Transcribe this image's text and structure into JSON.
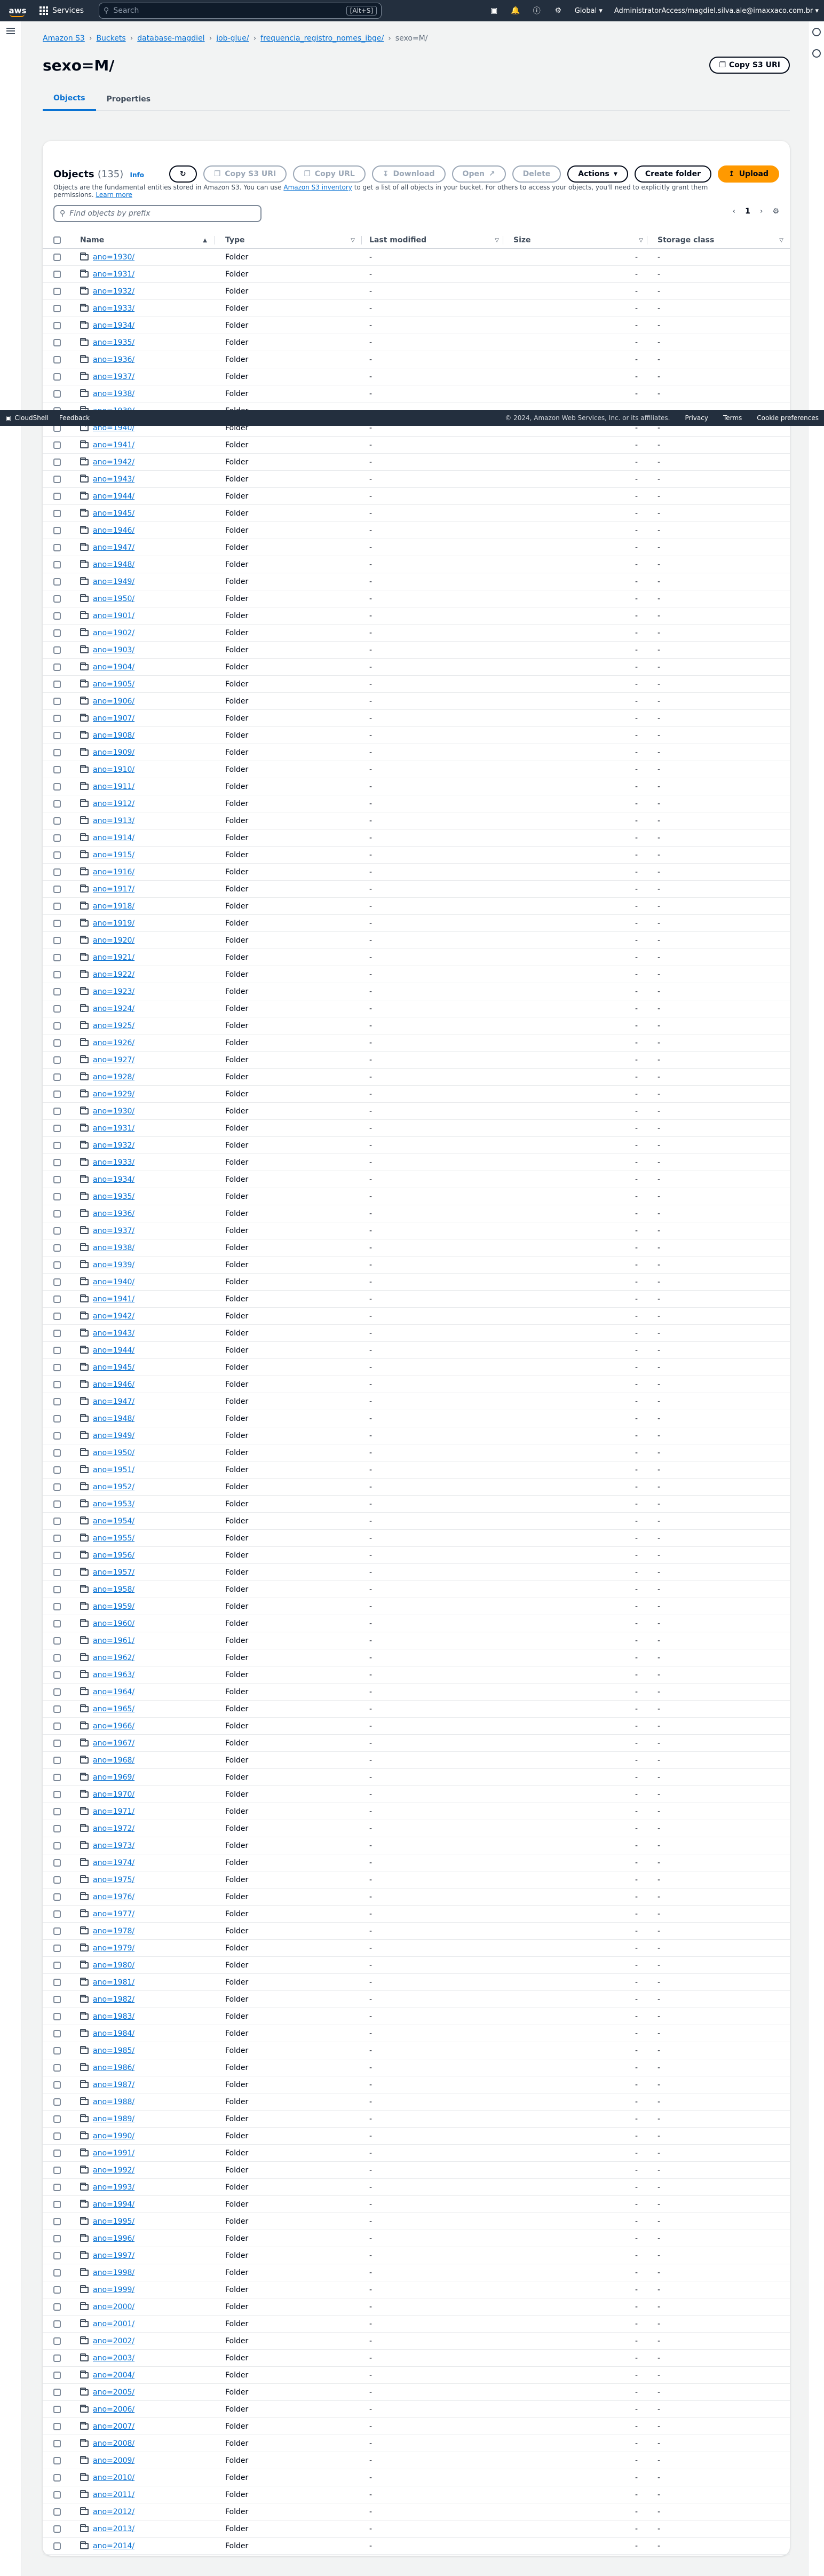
{
  "nav": {
    "logo": "aws",
    "services_label": "Services",
    "search_placeholder": "Search",
    "search_shortcut": "[Alt+S]",
    "region": "Global",
    "account": "AdministratorAccess/magdiel.silva.ale@imaxxaco.com.br"
  },
  "breadcrumb": [
    "Amazon S3",
    "Buckets",
    "database-magdiel",
    "job-glue/",
    "frequencia_registro_nomes_ibge/",
    "sexo=M/"
  ],
  "page": {
    "title": "sexo=M/",
    "copy_uri": "Copy S3 URI"
  },
  "tabs": [
    "Objects",
    "Properties"
  ],
  "objects": {
    "title": "Objects",
    "count": "(135)",
    "info": "Info",
    "desc_pre": "Objects are the fundamental entities stored in Amazon S3. You can use",
    "inventory_link": "Amazon S3 inventory",
    "desc_mid": "to get a list of all objects in your bucket. For others to access your objects, you'll need to explicitly grant them permissions.",
    "learn_more": "Learn more",
    "buttons": {
      "copy_uri": "Copy S3 URI",
      "copy_url": "Copy URL",
      "download": "Download",
      "open": "Open",
      "delete": "Delete",
      "actions": "Actions",
      "create_folder": "Create folder",
      "upload": "Upload"
    },
    "filter_placeholder": "Find objects by prefix",
    "page_number": "1",
    "columns": [
      "Name",
      "Type",
      "Last modified",
      "Size",
      "Storage class"
    ],
    "row_type": "Folder",
    "row_dash": "-",
    "names": [
      "ano=1930/",
      "ano=1931/",
      "ano=1932/",
      "ano=1933/",
      "ano=1934/",
      "ano=1935/",
      "ano=1936/",
      "ano=1937/",
      "ano=1938/",
      "ano=1939/",
      "ano=1940/",
      "ano=1941/",
      "ano=1942/",
      "ano=1943/",
      "ano=1944/",
      "ano=1945/",
      "ano=1946/",
      "ano=1947/",
      "ano=1948/",
      "ano=1949/",
      "ano=1950/",
      "ano=1901/",
      "ano=1902/",
      "ano=1903/",
      "ano=1904/",
      "ano=1905/",
      "ano=1906/",
      "ano=1907/",
      "ano=1908/",
      "ano=1909/",
      "ano=1910/",
      "ano=1911/",
      "ano=1912/",
      "ano=1913/",
      "ano=1914/",
      "ano=1915/",
      "ano=1916/",
      "ano=1917/",
      "ano=1918/",
      "ano=1919/",
      "ano=1920/",
      "ano=1921/",
      "ano=1922/",
      "ano=1923/",
      "ano=1924/",
      "ano=1925/",
      "ano=1926/",
      "ano=1927/",
      "ano=1928/",
      "ano=1929/",
      "ano=1930/",
      "ano=1931/",
      "ano=1932/",
      "ano=1933/",
      "ano=1934/",
      "ano=1935/",
      "ano=1936/",
      "ano=1937/",
      "ano=1938/",
      "ano=1939/",
      "ano=1940/",
      "ano=1941/",
      "ano=1942/",
      "ano=1943/",
      "ano=1944/",
      "ano=1945/",
      "ano=1946/",
      "ano=1947/",
      "ano=1948/",
      "ano=1949/",
      "ano=1950/",
      "ano=1951/",
      "ano=1952/",
      "ano=1953/",
      "ano=1954/",
      "ano=1955/",
      "ano=1956/",
      "ano=1957/",
      "ano=1958/",
      "ano=1959/",
      "ano=1960/",
      "ano=1961/",
      "ano=1962/",
      "ano=1963/",
      "ano=1964/",
      "ano=1965/",
      "ano=1966/",
      "ano=1967/",
      "ano=1968/",
      "ano=1969/",
      "ano=1970/",
      "ano=1971/",
      "ano=1972/",
      "ano=1973/",
      "ano=1974/",
      "ano=1975/",
      "ano=1976/",
      "ano=1977/",
      "ano=1978/",
      "ano=1979/",
      "ano=1980/",
      "ano=1981/",
      "ano=1982/",
      "ano=1983/",
      "ano=1984/",
      "ano=1985/",
      "ano=1986/",
      "ano=1987/",
      "ano=1988/",
      "ano=1989/",
      "ano=1990/",
      "ano=1991/",
      "ano=1992/",
      "ano=1993/",
      "ano=1994/",
      "ano=1995/",
      "ano=1996/",
      "ano=1997/",
      "ano=1998/",
      "ano=1999/",
      "ano=2000/",
      "ano=2001/",
      "ano=2002/",
      "ano=2003/",
      "ano=2004/",
      "ano=2005/",
      "ano=2006/",
      "ano=2007/",
      "ano=2008/",
      "ano=2009/",
      "ano=2010/",
      "ano=2011/",
      "ano=2012/",
      "ano=2013/",
      "ano=2014/"
    ]
  },
  "footer": {
    "cloudshell": "CloudShell",
    "feedback": "Feedback",
    "copyright": "© 2024, Amazon Web Services, Inc. or its affiliates.",
    "privacy": "Privacy",
    "terms": "Terms",
    "cookies": "Cookie preferences"
  }
}
